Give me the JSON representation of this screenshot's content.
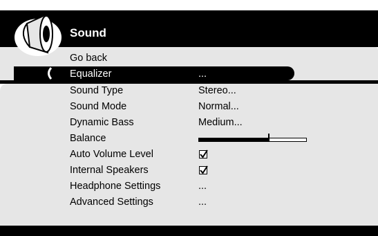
{
  "menu": {
    "title": "Sound",
    "icon": "speaker-icon",
    "items": [
      {
        "label": "Go back",
        "value": ""
      },
      {
        "label": "Equalizer",
        "value": "...",
        "selected": true
      },
      {
        "label": "Sound Type",
        "value": "Stereo..."
      },
      {
        "label": "Sound Mode",
        "value": "Normal..."
      },
      {
        "label": "Dynamic Bass",
        "value": "Medium..."
      },
      {
        "label": "Balance",
        "value": ""
      },
      {
        "label": "Auto Volume Level",
        "value": ""
      },
      {
        "label": "Internal Speakers",
        "value": ""
      },
      {
        "label": "Headphone Settings",
        "value": "..."
      },
      {
        "label": "Advanced Settings",
        "value": "..."
      }
    ]
  },
  "balance": {
    "level": 0.65
  },
  "auto_volume_level": {
    "checked": true
  },
  "internal_speakers": {
    "checked": true
  },
  "colors": {
    "frame": "#000000",
    "panel": "#e6e6e6",
    "highlight": "#000000",
    "text": "#000000"
  }
}
